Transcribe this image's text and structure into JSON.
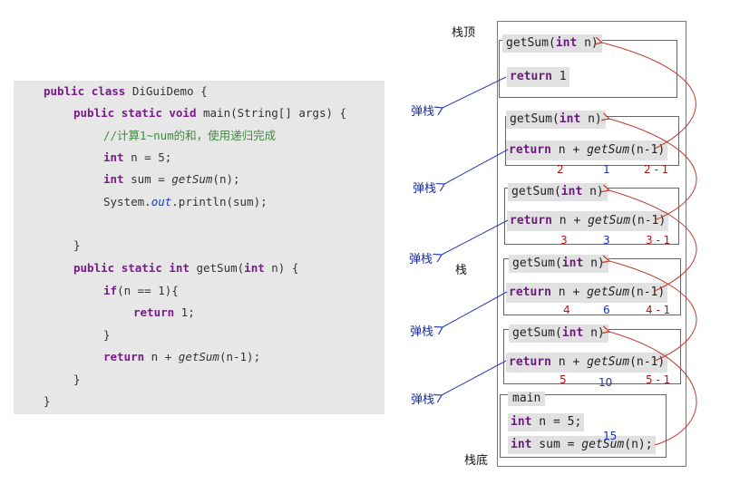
{
  "code": {
    "l1_kw1": "public",
    "l1_kw2": "class",
    "l1_rest": " DiGuiDemo {",
    "l2_kw1": "public",
    "l2_kw2": "static",
    "l2_kw3": "void",
    "l2_rest": " main(String[] args) {",
    "l3_comment": "//计算1~num的和，使用递归完成",
    "l4_kw": "int",
    "l4_rest": " n = 5;",
    "l5_kw": "int",
    "l5_rest": " sum = ",
    "l5_call": "getSum",
    "l5_end": "(n);",
    "l6_a": "System.",
    "l6_field": "out",
    "l6_b": ".println(sum);",
    "l7_brace": "}",
    "l8_kw1": "public",
    "l8_kw2": "static",
    "l8_kw3": "int",
    "l8_rest": " getSum(",
    "l8_kw4": "int",
    "l8_end": " n) {",
    "l9_kw": "if",
    "l9_rest": "(n == 1){",
    "l10_kw": "return",
    "l10_rest": " 1;",
    "l11_brace": "}",
    "l12_kw": "return",
    "l12_rest": " n + ",
    "l12_call": "getSum",
    "l12_end": "(n-1);",
    "l13_brace": "}",
    "l14_brace": "}"
  },
  "stack": {
    "top_label": "栈顶",
    "mid_label": "栈",
    "bottom_label": "栈底",
    "pop_label": "弹栈",
    "header_prefix": "getSum(",
    "header_kw": "int",
    "header_suffix": " n)",
    "return_kw": "return",
    "return_base": " 1",
    "return_expr_a": " n + ",
    "return_call": "getSum",
    "return_expr_b": "(n-1)",
    "main_title": "main",
    "main_line1_kw": "int",
    "main_line1_rest": " n = 5;",
    "main_line2_kw": "int",
    "main_line2_rest": " sum = ",
    "main_line2_call": "getSum",
    "main_line2_end": "(n);",
    "frames": [
      {
        "n": "2",
        "sub": "1",
        "expr": "2 - 1"
      },
      {
        "n": "3",
        "sub": "3",
        "expr": "3 - 1"
      },
      {
        "n": "4",
        "sub": "6",
        "expr": "4 - 1"
      },
      {
        "n": "5",
        "sub": "10",
        "expr": "5 - 1"
      }
    ],
    "main_result": "15"
  },
  "colors": {
    "keyword": "#7b1a8c",
    "comment": "#3d8a3d",
    "annotation_red": "#c01414",
    "annotation_blue": "#1432b4",
    "arrow_red": "#c0392b",
    "arrow_blue": "#2a3fb0"
  }
}
